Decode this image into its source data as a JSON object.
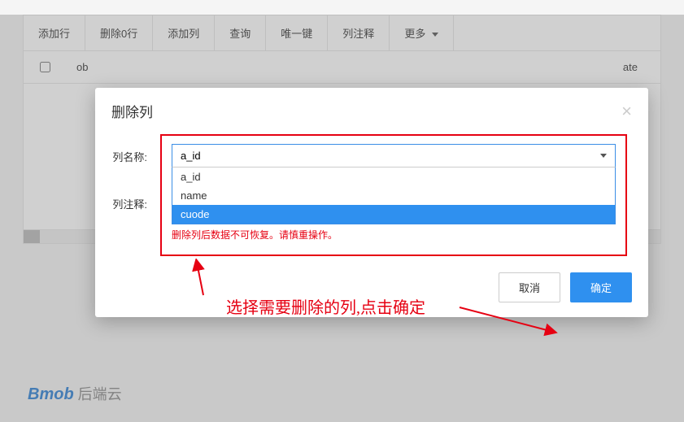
{
  "toolbar": {
    "add_row": "添加行",
    "delete_rows": "删除0行",
    "add_col": "添加列",
    "query": "查询",
    "unique_key": "唯一键",
    "col_comment": "列注释",
    "more": "更多"
  },
  "table": {
    "col1": "ob",
    "col_right": "ate"
  },
  "modal": {
    "title": "删除列",
    "label_name": "列名称:",
    "label_comment": "列注释:",
    "selected": "a_id",
    "options": [
      "a_id",
      "name",
      "cuode"
    ],
    "highlighted": "cuode",
    "warning": "删除列后数据不可恢复。请慎重操作。",
    "cancel": "取消",
    "confirm": "确定"
  },
  "annotation": "选择需要删除的列,点击确定",
  "brand": {
    "logo": "Bmob",
    "suffix": " 后端云"
  }
}
